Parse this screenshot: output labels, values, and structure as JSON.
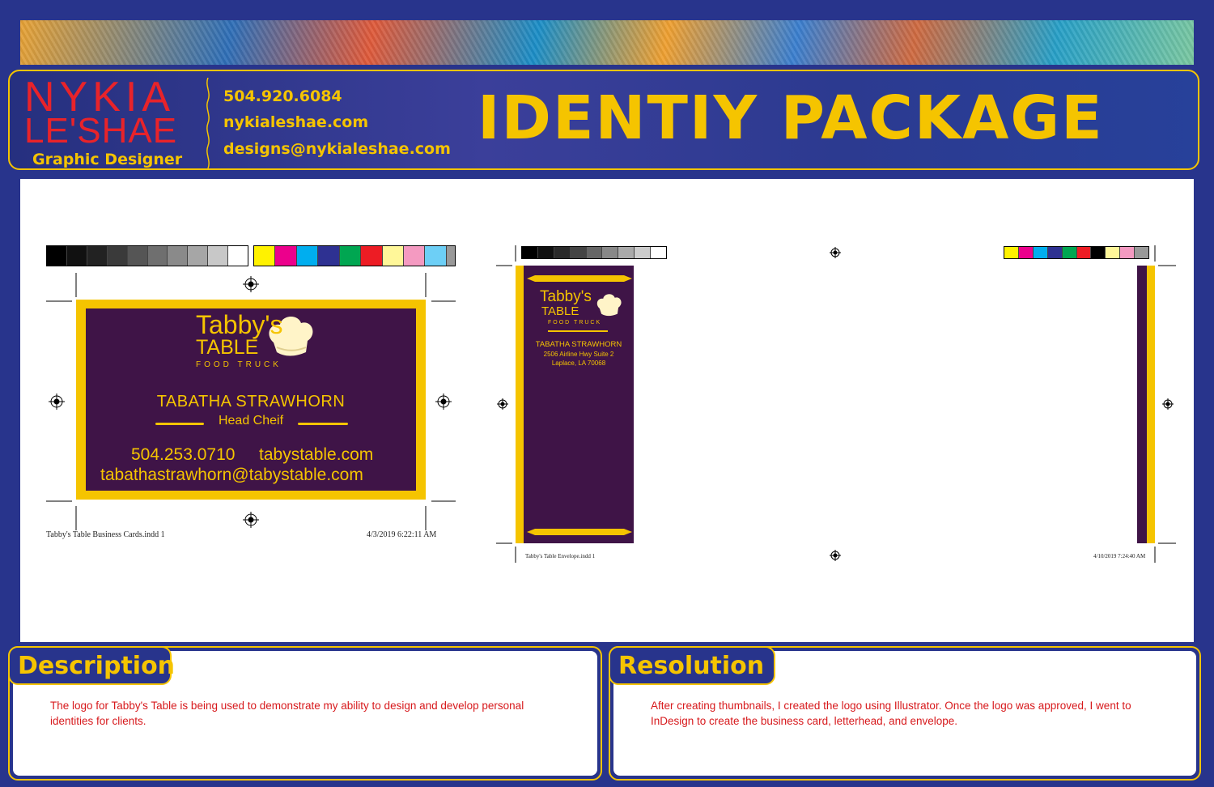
{
  "header": {
    "name_line1": "NYKIA",
    "name_line2": "LE'SHAE",
    "role": "Graphic Designer",
    "phone": "504.920.6084",
    "website": "nykialeshae.com",
    "email": "designs@nykialeshae.com",
    "title": "IDENTIY PACKAGE"
  },
  "business_card": {
    "logo_line1": "Tabby's",
    "logo_line2": "TABLE",
    "logo_line3": "FOOD TRUCK",
    "person": "TABATHA STRAWHORN",
    "position": "Head Cheif",
    "phone": "504.253.0710",
    "website": "tabystable.com",
    "email": "tabathastrawhorn@tabystable.com",
    "slug_file": "Tabby's Table Business Cards.indd   1",
    "slug_date": "4/3/2019   6:22:11 AM"
  },
  "envelope": {
    "logo_line1": "Tabby's",
    "logo_line2": "TABLE",
    "logo_line3": "FOOD TRUCK",
    "person": "TABATHA STRAWHORN",
    "address1": "2506 Airline Hwy Suite 2",
    "address2": "Laplace, LA 70068",
    "slug_file": "Tabby's Table Envelope.indd   1",
    "slug_date": "4/10/2019   7:24:40 AM"
  },
  "description": {
    "heading": "Description",
    "text": "The logo for Tabby's Table is being used to demonstrate my ability to design and develop personal identities for clients."
  },
  "resolution": {
    "heading": "Resolution",
    "text": "After creating thumbnails, I created the logo using Illustrator. Once the logo was approved, I went to InDesign to create the business card, letterhead, and envelope."
  },
  "colors": {
    "navy": "#28348c",
    "gold": "#f5c400",
    "purple": "#3f1447",
    "red": "#e8232a"
  }
}
